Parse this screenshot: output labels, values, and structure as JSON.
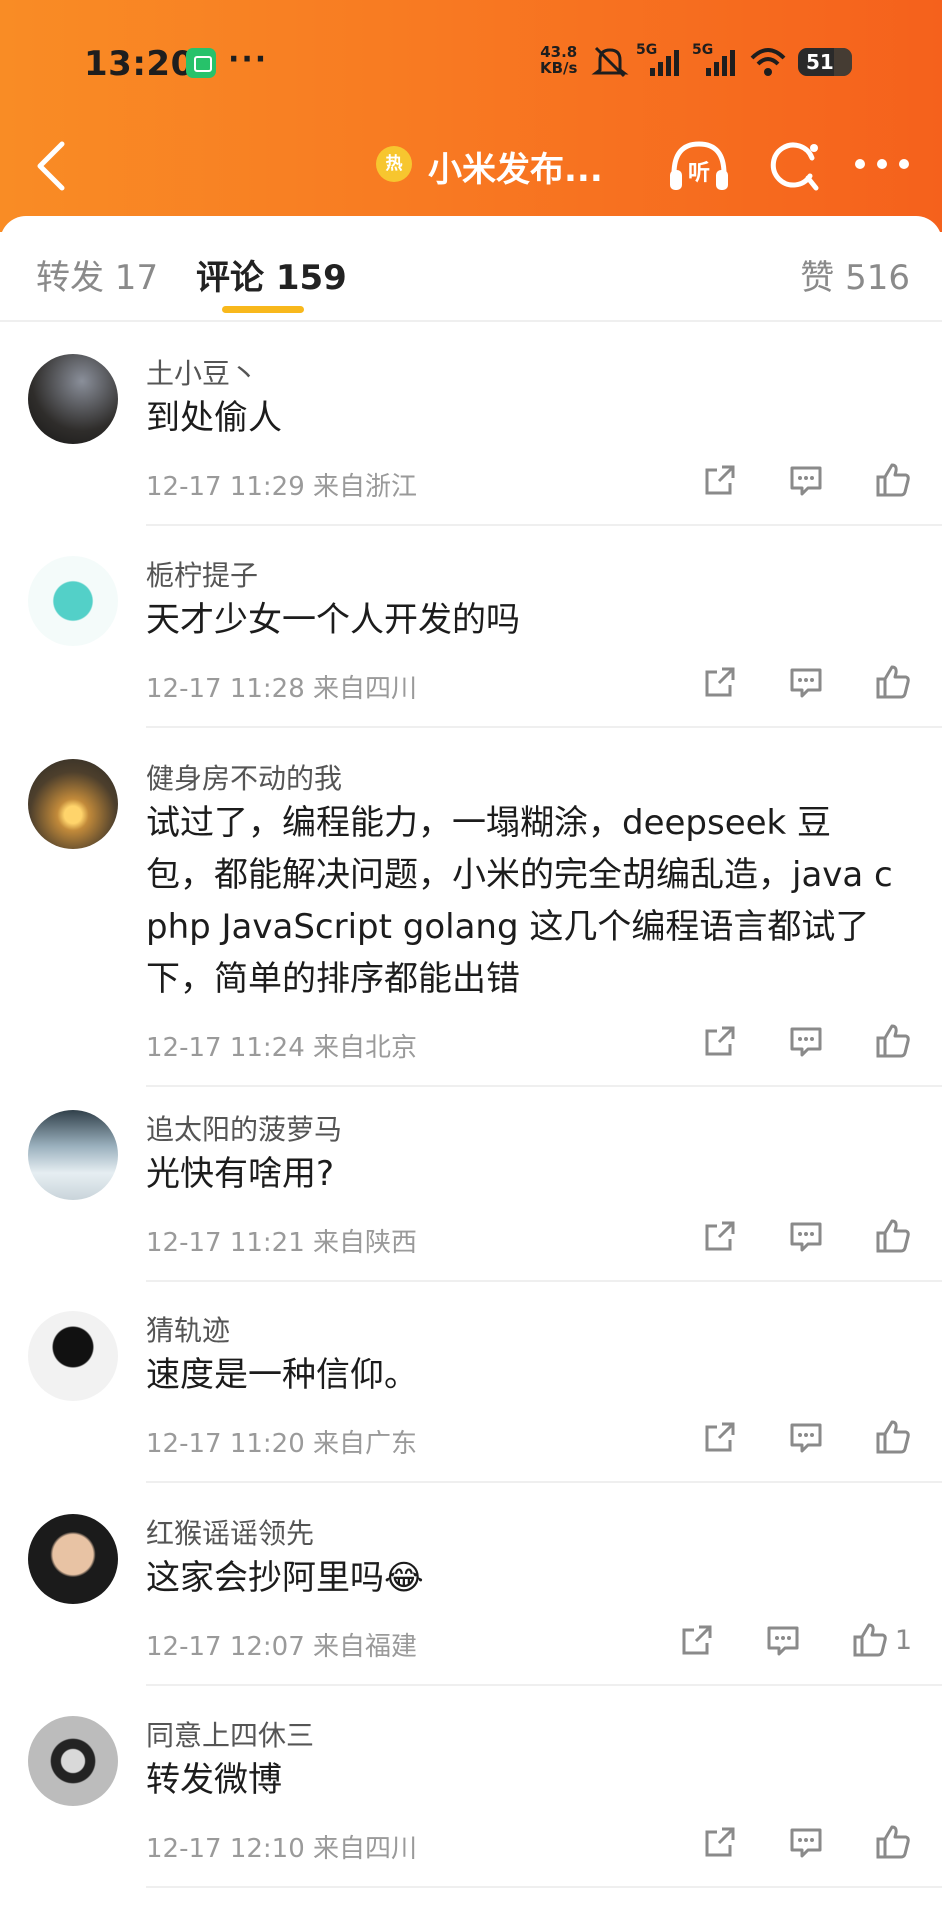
{
  "status_bar": {
    "time": "13:20",
    "dots": "···",
    "net_speed_value": "43.8",
    "net_speed_unit": "KB/s",
    "signal1": "5G",
    "signal2": "5G",
    "battery": "51"
  },
  "header": {
    "hot_badge": "热",
    "title": "小米发布..."
  },
  "tabs": {
    "forward": "转发 17",
    "comments": "评论 159",
    "likes": "赞 516"
  },
  "comments": [
    {
      "user": "土小豆丶",
      "lines": [
        "到处偷人"
      ],
      "meta": "12-17 11:29  来自浙江",
      "likes": ""
    },
    {
      "user": "栀柠提子",
      "lines": [
        "天才少女一个人开发的吗"
      ],
      "meta": "12-17 11:28  来自四川",
      "likes": ""
    },
    {
      "user": "健身房不动的我",
      "lines": [
        "试过了，编程能力，一塌糊涂，deepseek  豆",
        "包，都能解决问题，小米的完全胡编乱造，java  c",
        "php  JavaScript  golang 这几个编程语言都试了",
        "下，简单的排序都能出错"
      ],
      "meta": "12-17 11:24  来自北京",
      "likes": ""
    },
    {
      "user": "追太阳的菠萝马",
      "lines": [
        "光快有啥用?"
      ],
      "meta": "12-17 11:21  来自陕西",
      "likes": ""
    },
    {
      "user": "猜轨迹",
      "lines": [
        "速度是一种信仰。"
      ],
      "meta": "12-17 11:20  来自广东",
      "likes": ""
    },
    {
      "user": "红猴谣谣领先",
      "lines": [
        "这家会抄阿里吗😂"
      ],
      "meta": "12-17 12:07  来自福建",
      "likes": "1"
    },
    {
      "user": "同意上四休三",
      "lines": [
        "转发微博"
      ],
      "meta": "12-17 12:10  来自四川",
      "likes": ""
    }
  ]
}
